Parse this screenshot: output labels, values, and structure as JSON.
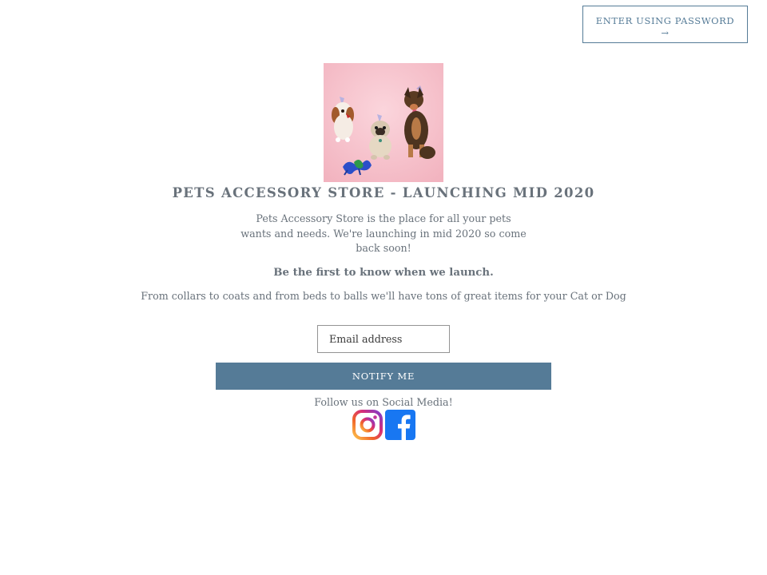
{
  "header": {
    "password_button_label": "ENTER USING PASSWORD",
    "password_button_arrow": "→"
  },
  "hero": {
    "title": "PETS ACCESSORY STORE - LAUNCHING MID 2020",
    "description": "Pets Accessory Store is the place for all your pets wants and needs. We're launching in mid 2020 so come back soon!",
    "cta_heading": "Be the first to know when we launch.",
    "subtext": "From collars to coats and from beds to balls we'll have tons of great items for your Cat or Dog"
  },
  "signup": {
    "email_placeholder": "Email address",
    "submit_label": "NOTIFY ME"
  },
  "social": {
    "follow_text": "Follow us on Social Media!",
    "icons": [
      "instagram-icon",
      "facebook-icon"
    ]
  },
  "colors": {
    "accent": "#557b97",
    "text": "#69727b",
    "hero_background": "#f6c3cc",
    "facebook": "#1877f2"
  }
}
